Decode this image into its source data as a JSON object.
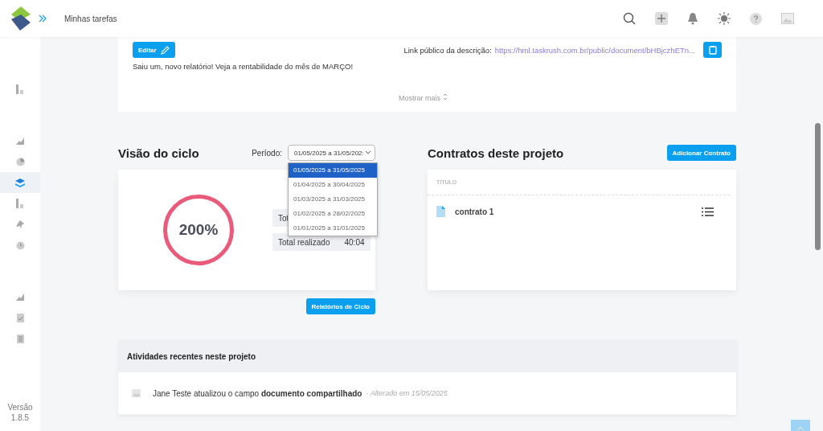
{
  "topbar": {
    "title": "Minhas tarefas"
  },
  "sidebar": {
    "items": [
      {
        "selected": false
      },
      {
        "selected": false
      },
      {
        "selected": false
      },
      {
        "selected": true
      },
      {
        "selected": false
      },
      {
        "selected": false
      },
      {
        "selected": false
      },
      {
        "selected": false
      },
      {
        "selected": false
      },
      {
        "selected": false
      }
    ],
    "version_label": "Versão",
    "version": "1.8.5"
  },
  "description": {
    "edit_button": "Editar",
    "text": "Saiu um, novo relatório! Veja a rentabilidade do mês de MARÇO!",
    "link_label": "Link público da descrição:",
    "link": "https://hml.taskrush.com.br/public/document/bHBjczhETn...",
    "show_more": "Mostrar mais"
  },
  "cycle": {
    "title": "Visão do ciclo",
    "period_label": "Período:",
    "period_value": "01/05/2025 a 31/05/202:",
    "percent": "200%",
    "stats": [
      {
        "label": "Tot"
      },
      {
        "label": "Total realizado",
        "value": "40:04"
      }
    ],
    "period_options": [
      {
        "label": "01/05/2025 a 31/05/2025",
        "selected": true
      },
      {
        "label": "01/04/2025 a 30/04/2025",
        "selected": false
      },
      {
        "label": "01/03/2025 a 31/03/2025",
        "selected": false
      },
      {
        "label": "01/02/2025 a 28/02/2025",
        "selected": false
      },
      {
        "label": "01/01/2025 a 31/01/2025",
        "selected": false
      }
    ],
    "report_button": "Relatórios de Ciclo"
  },
  "contracts": {
    "title": "Contratos deste projeto",
    "add_button": "Adicionar Contrato",
    "column": "TÍTULO",
    "rows": [
      {
        "name": "contrato 1"
      }
    ]
  },
  "activity": {
    "title": "Atividades recentes neste projeto",
    "rows": [
      {
        "text": "Jane Teste atualizou o campo **documento compartilhado**",
        "meta": "- Alterado em 15/05/2025"
      }
    ]
  }
}
